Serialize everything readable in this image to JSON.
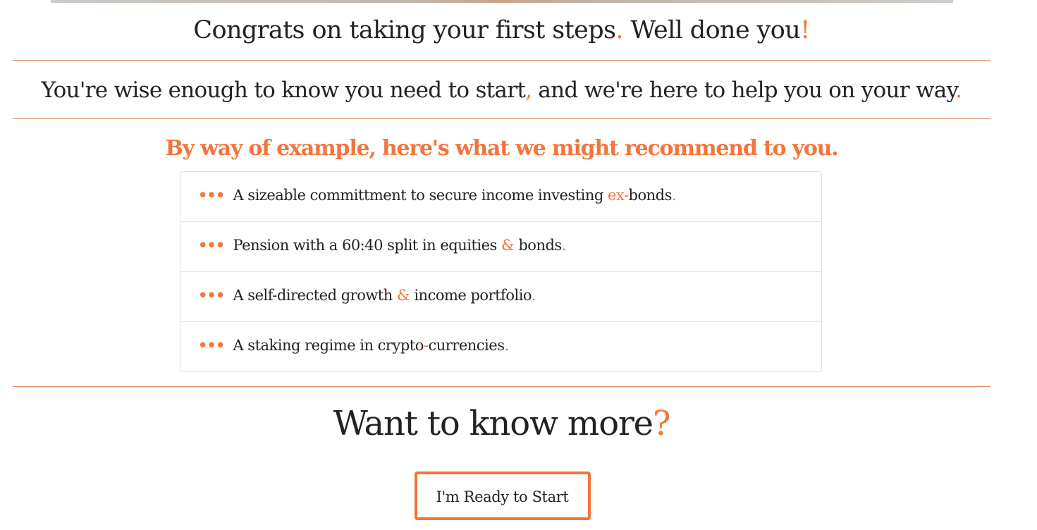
{
  "colors": {
    "accent": "#f4743b",
    "text": "#222222",
    "divider": "#e08a62",
    "border": "#e2e2e2"
  },
  "congrats": {
    "text": "Congrats on taking your first steps",
    "dot": ".",
    "text2": " Well done you",
    "bang": "!"
  },
  "wise": {
    "text": "You're wise enough to know you need to start",
    "comma": ",",
    "text2": " and we're here to help you on your way",
    "dot": "."
  },
  "example": {
    "title": "By way of example, here's what we might recommend to you."
  },
  "recommendations": {
    "bullet": "•••",
    "items": [
      {
        "before": " A sizeable committment to secure income investing ",
        "accent": "ex-",
        "after": "bonds",
        "end": "."
      },
      {
        "before": " Pension with a 60:40 split in equities ",
        "accent": "&",
        "after": " bonds",
        "end": "."
      },
      {
        "before": " A self-directed growth ",
        "accent": "&",
        "after": " income portfolio",
        "end": "."
      },
      {
        "before": " A staking regime in crypto",
        "accent": "-",
        "after": "currencies",
        "end": "."
      }
    ]
  },
  "more": {
    "text": "Want to know more",
    "q": "?"
  },
  "cta": {
    "label": "I'm Ready to Start"
  }
}
